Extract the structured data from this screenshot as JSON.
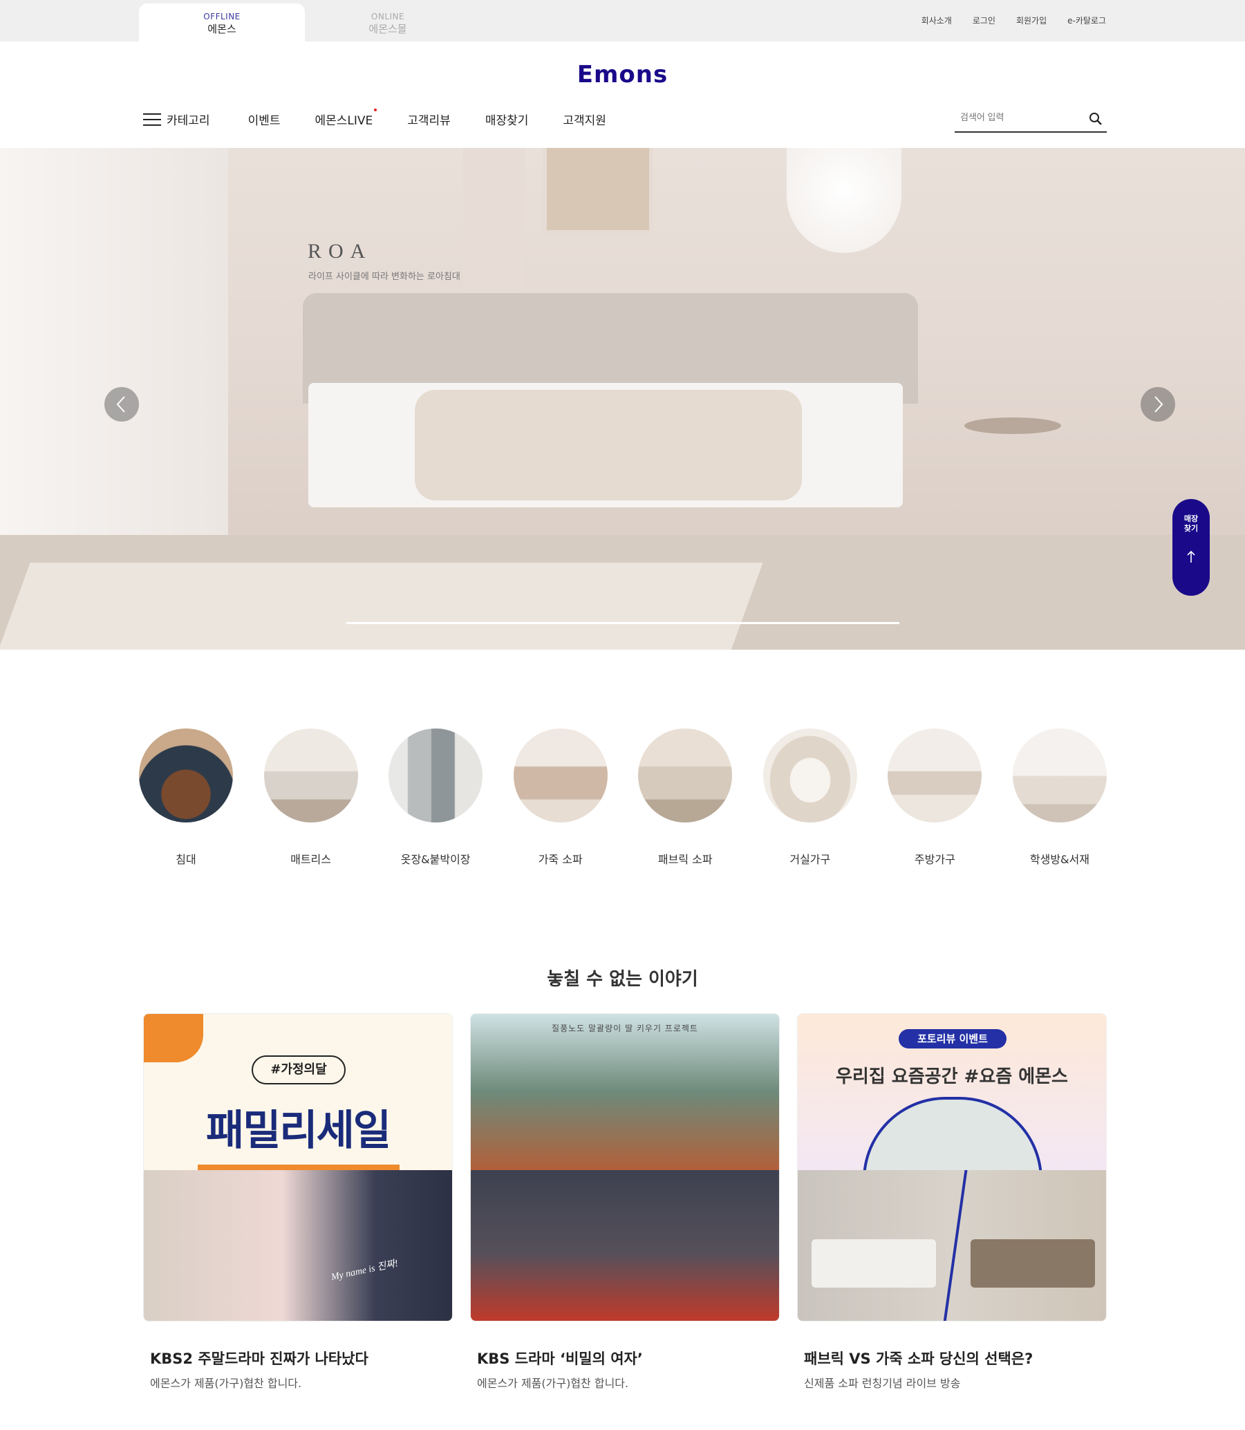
{
  "top_tabs": [
    {
      "small": "OFFLINE",
      "big": "에몬스",
      "active": true
    },
    {
      "small": "ONLINE",
      "big": "에몬스몰",
      "active": false
    }
  ],
  "top_links": [
    "회사소개",
    "로그인",
    "회원가입",
    "e-카탈로그"
  ],
  "logo": "Emons",
  "nav": {
    "category": "카테고리",
    "items": [
      "이벤트",
      "에몬스LIVE",
      "고객리뷰",
      "매장찾기",
      "고객지원"
    ]
  },
  "search": {
    "placeholder": "검색어 입력"
  },
  "hero": {
    "title": "ROA",
    "subtitle": "라이프 사이클에 따라 변화하는 로아침대"
  },
  "store_button": {
    "line1": "매장",
    "line2": "찾기"
  },
  "categories": [
    "침대",
    "매트리스",
    "옷장&붙박이장",
    "가죽 소파",
    "패브릭 소파",
    "거실가구",
    "주방가구",
    "학생방&서재"
  ],
  "section_title": "놓칠 수 없는 이야기",
  "cards": [
    {
      "title": "KBS2 주말드라마 진짜가 나타났다",
      "subtitle": "에몬스가 제품(가구)협찬 합니다.",
      "img_pill": "#가정의달",
      "img_title": "패밀리세일",
      "img_tag": "My name is 진짜!"
    },
    {
      "title": "KBS 드라마 ‘비밀의 여자’",
      "subtitle": "에몬스가 제품(가구)협찬 합니다.",
      "img_caption": "질풍노도 말괄량이 딸 키우기 프로젝트"
    },
    {
      "title": "패브릭 VS 가죽 소파 당신의 선택은?",
      "subtitle": "신제품 소파 런칭기념 라이브 방송",
      "img_badge": "포토리뷰 이벤트",
      "img_headline": "우리집 요즘공간 #요즘 에몬스"
    }
  ],
  "colors": {
    "brand": "#1a0a8a",
    "accent": "#ef8a2d"
  }
}
